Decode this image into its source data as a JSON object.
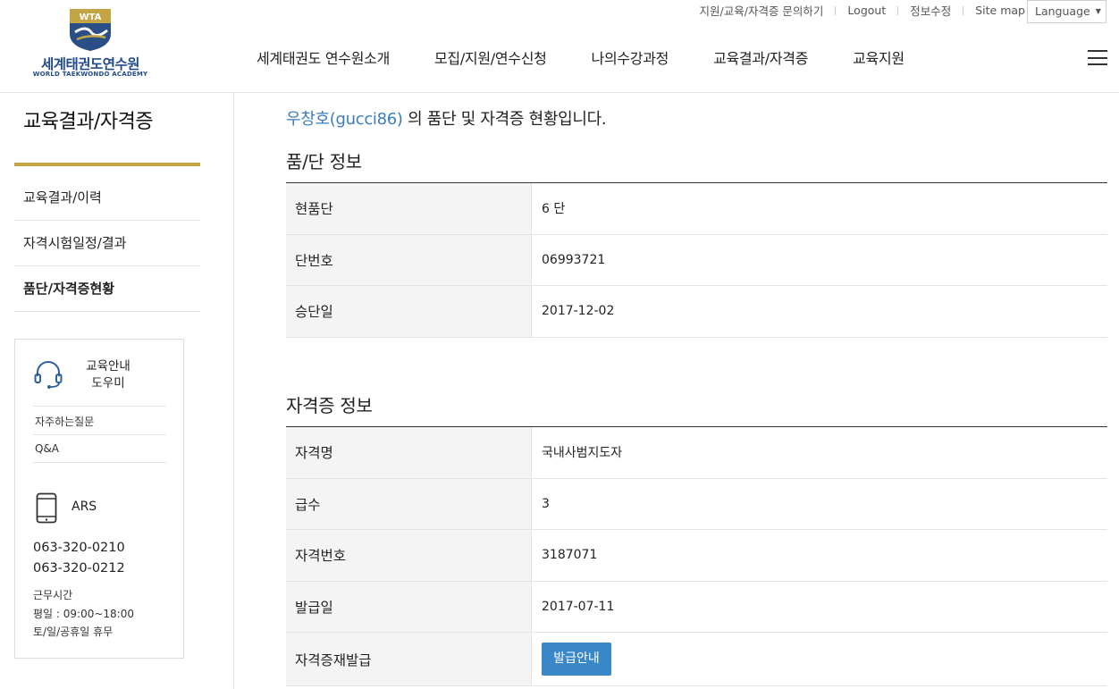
{
  "header": {
    "logo": {
      "emblem_text": "WTA",
      "name_ko": "세계태권도연수원",
      "name_en": "WORLD TAEKWONDO ACADEMY"
    },
    "util_links": [
      "지원/교육/자격증 문의하기",
      "Logout",
      "정보수정",
      "Site map"
    ],
    "language_label": "Language",
    "gnb": [
      "세계태권도 연수원소개",
      "모집/지원/연수신청",
      "나의수강과정",
      "교육결과/자격증",
      "교육지원"
    ]
  },
  "sidebar": {
    "title": "교육결과/자격증",
    "menu": [
      {
        "label": "교육결과/이력",
        "active": false
      },
      {
        "label": "자격시험일정/결과",
        "active": false
      },
      {
        "label": "품단/자격증현황",
        "active": true
      }
    ],
    "help": {
      "title_line1": "교육안내",
      "title_line2": "도우미",
      "links": [
        "자주하는질문",
        "Q&A"
      ],
      "ars_label": "ARS",
      "tel1": "063-320-0210",
      "tel2": "063-320-0212",
      "hours_title": "근무시간",
      "hours_weekday": "평일 : 09:00~18:00",
      "hours_holiday": "토/일/공휴일 휴무"
    }
  },
  "main": {
    "intro_user": "우창호(gucci86)",
    "intro_rest": " 의 품단 및 자격증 현황입니다.",
    "poom_dan": {
      "title": "품/단 정보",
      "rows": [
        {
          "label": "현품단",
          "value": "6 단"
        },
        {
          "label": "단번호",
          "value": "06993721"
        },
        {
          "label": "승단일",
          "value": "2017-12-02"
        }
      ]
    },
    "license": {
      "title": "자격증 정보",
      "rows": [
        {
          "label": "자격명",
          "value": "국내사범지도자"
        },
        {
          "label": "급수",
          "value": "3"
        },
        {
          "label": "자격번호",
          "value": "3187071"
        },
        {
          "label": "발급일",
          "value": "2017-07-11"
        }
      ],
      "reissue_label": "자격증재발급",
      "reissue_button": "발급안내"
    }
  },
  "colors": {
    "accent_gold": "#c4a546",
    "link_blue": "#3a7dbf",
    "button_blue": "#3a87c8",
    "logo_navy": "#234c8c"
  }
}
